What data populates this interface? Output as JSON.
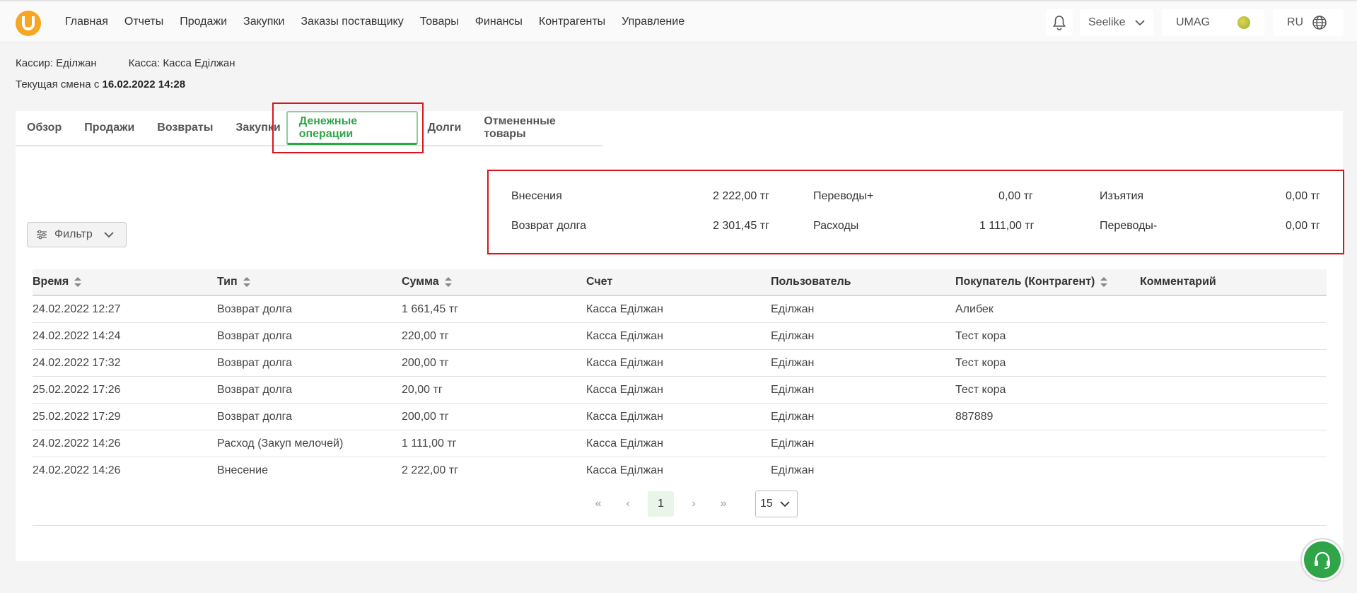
{
  "nav": {
    "items": [
      "Главная",
      "Отчеты",
      "Продажи",
      "Закупки",
      "Заказы поставщику",
      "Товары",
      "Финансы",
      "Контрагенты",
      "Управление"
    ],
    "store_select": "Seelike",
    "company": "UMAG",
    "language": "RU"
  },
  "info": {
    "cashier_label": "Кассир:",
    "cashier": "Еділжан",
    "till_label": "Касса:",
    "till": "Касса Еділжан",
    "shift_label": "Текущая смена с",
    "shift_start": "16.02.2022 14:28"
  },
  "tabs": [
    "Обзор",
    "Продажи",
    "Возвраты",
    "Закупки",
    "Денежные операции",
    "Долги",
    "Отмененные товары"
  ],
  "active_tab": "Денежные операции",
  "summary": {
    "deposits_label": "Внесения",
    "deposits": "2 222,00 тг",
    "transfers_in_label": "Переводы+",
    "transfers_in": "0,00 тг",
    "withdrawals_label": "Изъятия",
    "withdrawals": "0,00 тг",
    "debt_return_label": "Возврат долга",
    "debt_return": "2 301,45 тг",
    "expenses_label": "Расходы",
    "expenses": "1 111,00 тг",
    "transfers_out_label": "Переводы-",
    "transfers_out": "0,00 тг"
  },
  "filter": {
    "label": "Фильтр"
  },
  "table": {
    "columns": [
      "Время",
      "Тип",
      "Сумма",
      "Счет",
      "Пользователь",
      "Покупатель (Контрагент)",
      "Комментарий"
    ],
    "rows": [
      [
        "24.02.2022 12:27",
        "Возврат долга",
        "1 661,45 тг",
        "Касса Еділжан",
        "Еділжан",
        "Алибек",
        ""
      ],
      [
        "24.02.2022 14:24",
        "Возврат долга",
        "220,00 тг",
        "Касса Еділжан",
        "Еділжан",
        "Тест кора",
        ""
      ],
      [
        "24.02.2022 17:32",
        "Возврат долга",
        "200,00 тг",
        "Касса Еділжан",
        "Еділжан",
        "Тест кора",
        ""
      ],
      [
        "25.02.2022 17:26",
        "Возврат долга",
        "20,00 тг",
        "Касса Еділжан",
        "Еділжан",
        "Тест кора",
        ""
      ],
      [
        "25.02.2022 17:29",
        "Возврат долга",
        "200,00 тг",
        "Касса Еділжан",
        "Еділжан",
        "887889",
        ""
      ],
      [
        "24.02.2022 14:26",
        "Расход (Закуп мелочей)",
        "1 111,00 тг",
        "Касса Еділжан",
        "Еділжан",
        "",
        ""
      ],
      [
        "24.02.2022 14:26",
        "Внесение",
        "2 222,00 тг",
        "Касса Еділжан",
        "Еділжан",
        "",
        ""
      ]
    ]
  },
  "pagination": {
    "first": "«",
    "prev": "‹",
    "current": "1",
    "next": "›",
    "last": "»",
    "per_page": "15"
  },
  "colors": {
    "accent": "#2fa548",
    "highlight": "#d9151c",
    "logo": "#f5a623"
  }
}
